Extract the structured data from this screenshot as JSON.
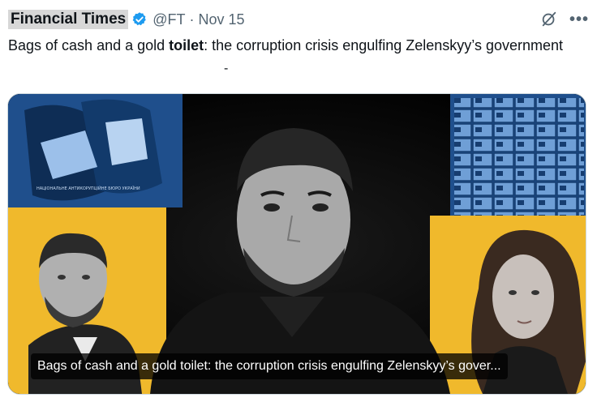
{
  "tweet": {
    "author": "Financial Times",
    "handle": "@FT",
    "separator": "·",
    "date": "Nov 15",
    "text_before": "Bags of cash and a gold ",
    "text_bold": "toilet",
    "text_after": ": the corruption crisis engulfing Zelenskyy’s government",
    "more_label": "•••",
    "stray_mark": "-"
  },
  "card": {
    "caption": "Bags of cash and a gold toilet: the corruption crisis engulfing Zelenskyy’s gover...",
    "panel_text": "НАЦІОНАЛЬНЕ АНТИКОРУПЦІЙНЕ БЮРО УКРАЇНИ"
  },
  "colors": {
    "accent_yellow": "#f0b92c",
    "duotone_blue": "#1f4f8c",
    "verified_blue": "#1d9bf0"
  },
  "icons": [
    "verified-badge-icon",
    "grok-icon",
    "more-icon"
  ]
}
